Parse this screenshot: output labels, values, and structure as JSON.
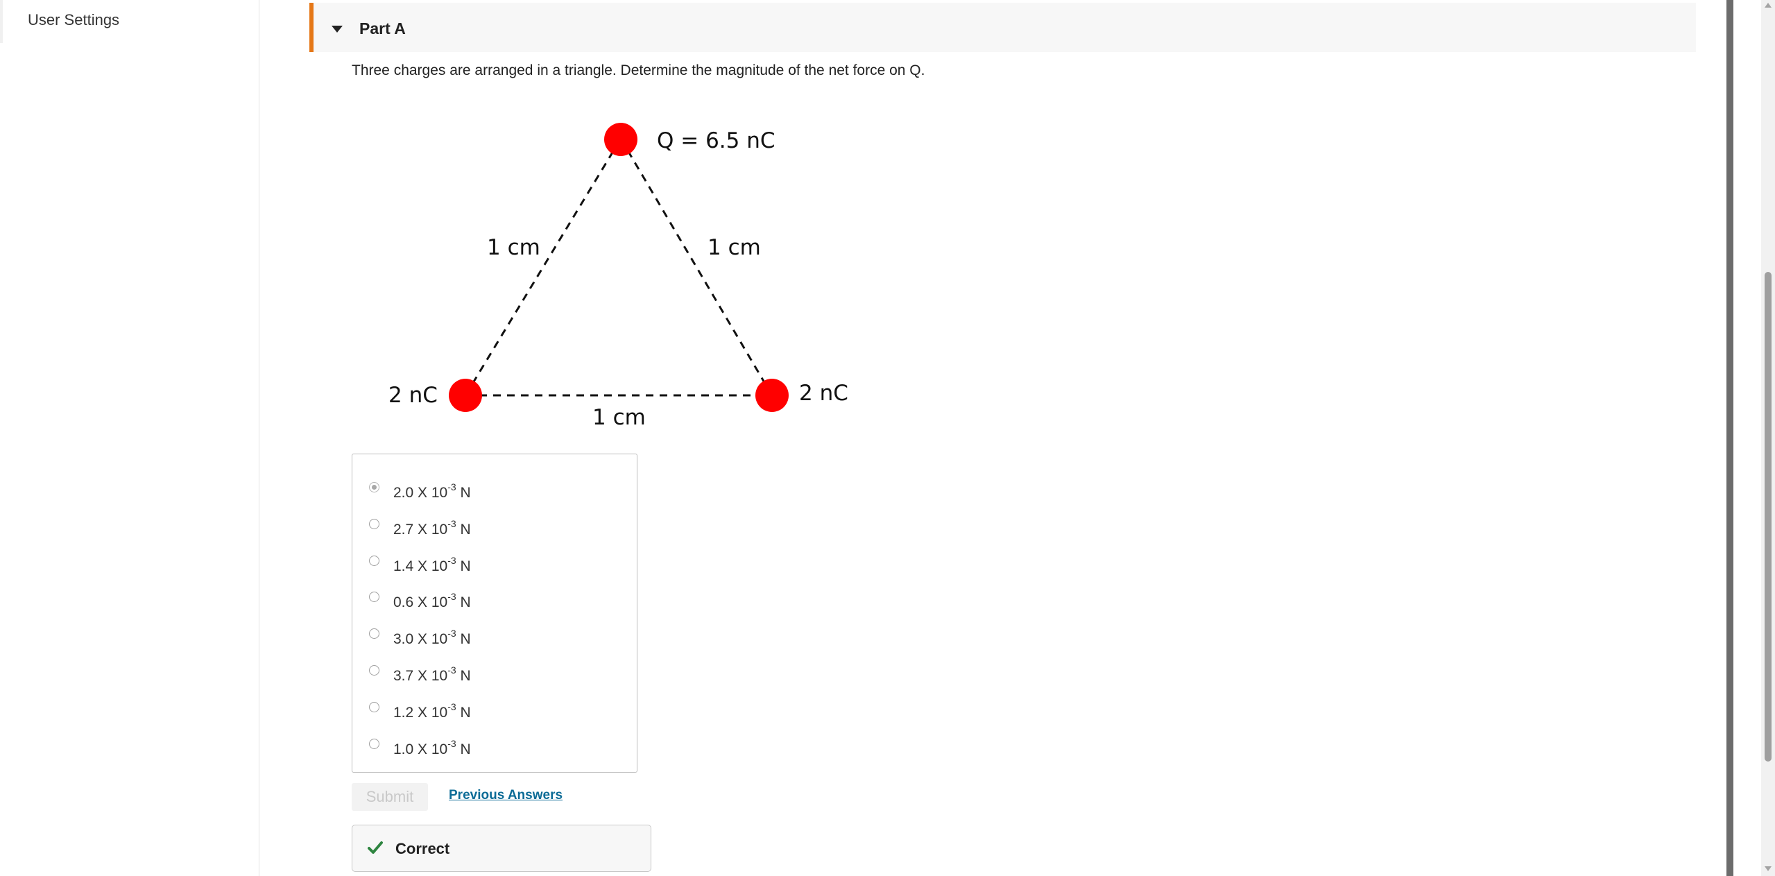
{
  "sidebar": {
    "items": [
      {
        "label": "User Settings"
      }
    ]
  },
  "part": {
    "title": "Part A",
    "question": "Three charges are arranged in a triangle. Determine the magnitude of the net force on Q."
  },
  "diagram": {
    "top_charge_label": "Q = 6.5 nC",
    "left_charge_label": "2 nC",
    "right_charge_label": "2 nC",
    "left_side_label": "1 cm",
    "right_side_label": "1 cm",
    "bottom_side_label": "1 cm",
    "charge_color": "#ff0000"
  },
  "choices": [
    {
      "mantissa": "2.0 X 10",
      "exponent": "-3",
      "unit": "N",
      "selected": true
    },
    {
      "mantissa": "2.7 X 10",
      "exponent": "-3",
      "unit": "N",
      "selected": false
    },
    {
      "mantissa": "1.4 X 10",
      "exponent": "-3",
      "unit": "N",
      "selected": false
    },
    {
      "mantissa": "0.6 X 10",
      "exponent": "-3",
      "unit": "N",
      "selected": false
    },
    {
      "mantissa": "3.0 X 10",
      "exponent": "-3",
      "unit": "N",
      "selected": false
    },
    {
      "mantissa": "3.7 X 10",
      "exponent": "-3",
      "unit": "N",
      "selected": false
    },
    {
      "mantissa": "1.2 X 10",
      "exponent": "-3",
      "unit": "N",
      "selected": false
    },
    {
      "mantissa": "1.0 X 10",
      "exponent": "-3",
      "unit": "N",
      "selected": false
    }
  ],
  "actions": {
    "submit_label": "Submit",
    "previous_answers_label": "Previous Answers"
  },
  "feedback": {
    "label": "Correct",
    "icon": "check-icon",
    "color": "#2e8540"
  },
  "colors": {
    "accent": "#e57717",
    "link": "#0b6b96"
  }
}
